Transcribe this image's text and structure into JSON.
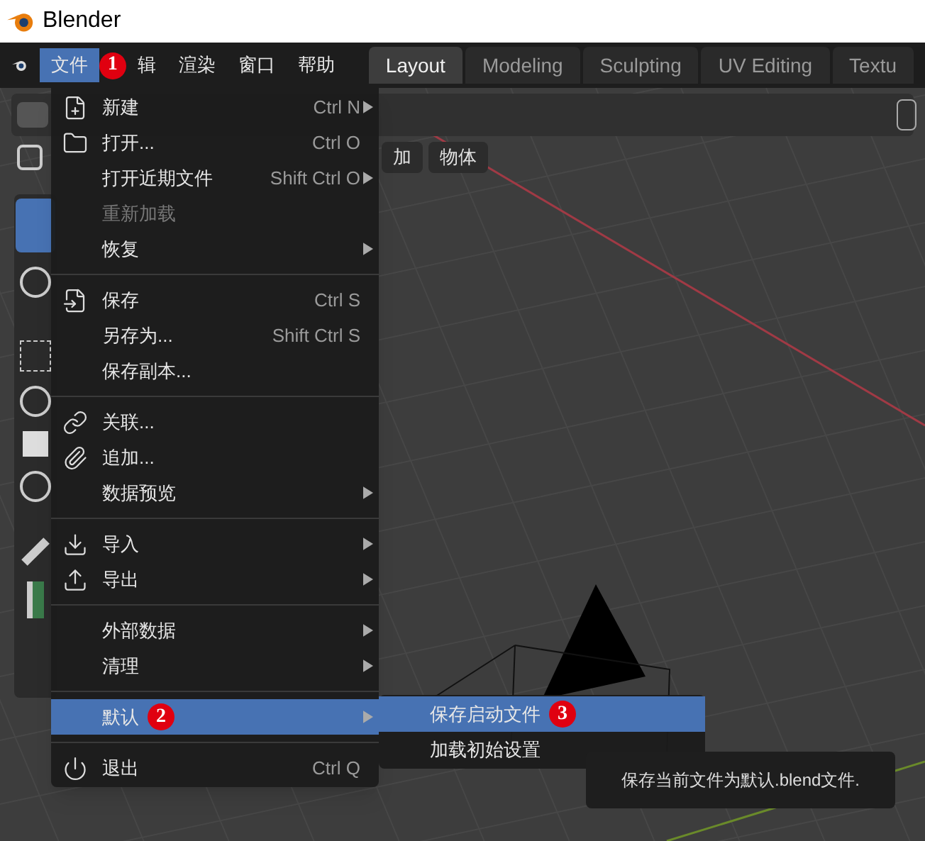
{
  "window": {
    "title": "Blender"
  },
  "menubar": [
    {
      "label": "文件",
      "selected": true,
      "badge": "1"
    },
    {
      "label": "辑",
      "selected": false
    },
    {
      "label": "渲染",
      "selected": false
    },
    {
      "label": "窗口",
      "selected": false
    },
    {
      "label": "帮助",
      "selected": false
    }
  ],
  "workspace_tabs": [
    {
      "label": "Layout",
      "selected": true
    },
    {
      "label": "Modeling",
      "selected": false
    },
    {
      "label": "Sculpting",
      "selected": false
    },
    {
      "label": "UV Editing",
      "selected": false
    },
    {
      "label": "Textu",
      "selected": false
    }
  ],
  "header_buttons": [
    "加",
    "物体"
  ],
  "file_menu": [
    {
      "kind": "item",
      "label": "新建",
      "shortcut": "Ctrl N",
      "submenu": true,
      "disabled": false,
      "selected": false
    },
    {
      "kind": "item",
      "label": "打开...",
      "shortcut": "Ctrl O",
      "submenu": false,
      "disabled": false,
      "selected": false
    },
    {
      "kind": "item",
      "label": "打开近期文件",
      "shortcut": "Shift Ctrl O",
      "submenu": true,
      "disabled": false,
      "selected": false
    },
    {
      "kind": "item",
      "label": "重新加载",
      "submenu": false,
      "disabled": true,
      "selected": false
    },
    {
      "kind": "item",
      "label": "恢复",
      "submenu": true,
      "disabled": false,
      "selected": false
    },
    {
      "kind": "separator"
    },
    {
      "kind": "item",
      "label": "保存",
      "shortcut": "Ctrl S",
      "submenu": false,
      "disabled": false,
      "selected": false
    },
    {
      "kind": "item",
      "label": "另存为...",
      "shortcut": "Shift Ctrl S",
      "submenu": false,
      "disabled": false,
      "selected": false
    },
    {
      "kind": "item",
      "label": "保存副本...",
      "submenu": false,
      "disabled": false,
      "selected": false
    },
    {
      "kind": "separator"
    },
    {
      "kind": "item",
      "label": "关联...",
      "submenu": false,
      "disabled": false,
      "selected": false
    },
    {
      "kind": "item",
      "label": "追加...",
      "submenu": false,
      "disabled": false,
      "selected": false
    },
    {
      "kind": "item",
      "label": "数据预览",
      "submenu": true,
      "disabled": false,
      "selected": false
    },
    {
      "kind": "separator"
    },
    {
      "kind": "item",
      "label": "导入",
      "submenu": true,
      "disabled": false,
      "selected": false
    },
    {
      "kind": "item",
      "label": "导出",
      "submenu": true,
      "disabled": false,
      "selected": false
    },
    {
      "kind": "separator"
    },
    {
      "kind": "item",
      "label": "外部数据",
      "submenu": true,
      "disabled": false,
      "selected": false
    },
    {
      "kind": "item",
      "label": "清理",
      "submenu": true,
      "disabled": false,
      "selected": false
    },
    {
      "kind": "separator"
    },
    {
      "kind": "item",
      "label": "默认",
      "submenu": true,
      "disabled": false,
      "selected": true,
      "badge": "2"
    },
    {
      "kind": "separator"
    },
    {
      "kind": "item",
      "label": "退出",
      "shortcut": "Ctrl Q",
      "submenu": false,
      "disabled": false,
      "selected": false
    }
  ],
  "submenu": [
    {
      "label": "保存启动文件",
      "selected": true,
      "badge": "3"
    },
    {
      "label": "加载初始设置",
      "selected": false
    }
  ],
  "tooltip": "保存当前文件为默认.blend文件."
}
